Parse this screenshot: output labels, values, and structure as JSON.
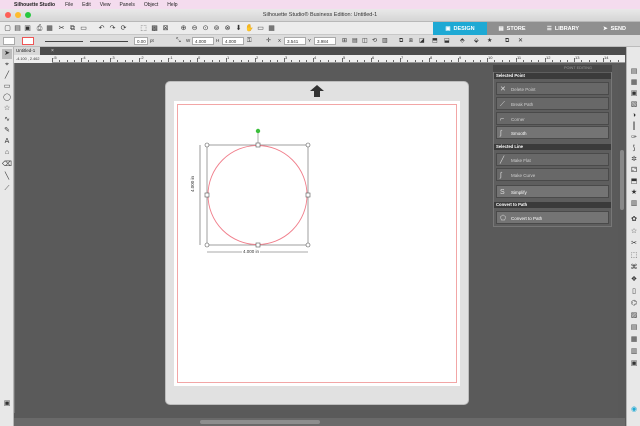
{
  "menubar": {
    "apple": "",
    "app_name": "Silhouette Studio",
    "items": [
      "File",
      "Edit",
      "View",
      "Panels",
      "Object",
      "Help"
    ]
  },
  "window": {
    "title": "Silhouette Studio® Business Edition: Untitled-1"
  },
  "toolbar": {
    "tabs": {
      "design": "DESIGN",
      "store": "STORE",
      "library": "LIBRARY",
      "send": "SEND"
    }
  },
  "propbar": {
    "stroke_width": "0.00",
    "stroke_unit": "pt",
    "width": "4.000",
    "height": "4.000",
    "x": "3.541",
    "y": "3.984",
    "dash_label": "W",
    "height_label": "H",
    "x_label": "X",
    "y_label": "Y"
  },
  "doc": {
    "tab_label": "Untitled-1",
    "close": "×",
    "coords": "-4.100 , 2.462"
  },
  "ruler": {
    "labels": [
      "-5",
      "-4",
      "-3",
      "-2",
      "-1",
      "0",
      "1",
      "2",
      "3",
      "4",
      "5",
      "6",
      "7",
      "8",
      "9",
      "10",
      "11",
      "12",
      "13",
      "14",
      "15",
      "16",
      "17"
    ]
  },
  "selection": {
    "width_label": "4.000 in",
    "height_label": "4.000 in"
  },
  "point_panel": {
    "header_caption": "POINT EDITING",
    "selected_point": "Selected Point",
    "delete_point": "Delete Point",
    "break_path": "Break Path",
    "corner": "Corner",
    "smooth": "Smooth",
    "selected_line": "Selected Line",
    "make_flat": "Make Flat",
    "make_curve": "Make Curve",
    "simplify": "Simplify",
    "convert_header": "Convert to Path",
    "convert_to_path": "Convert to Path"
  },
  "colors": {
    "accent": "#1ea9d4",
    "menubar": "#f4dcee",
    "cut_line": "#f2a6a6",
    "rotate_handle": "#3cbf3c"
  }
}
